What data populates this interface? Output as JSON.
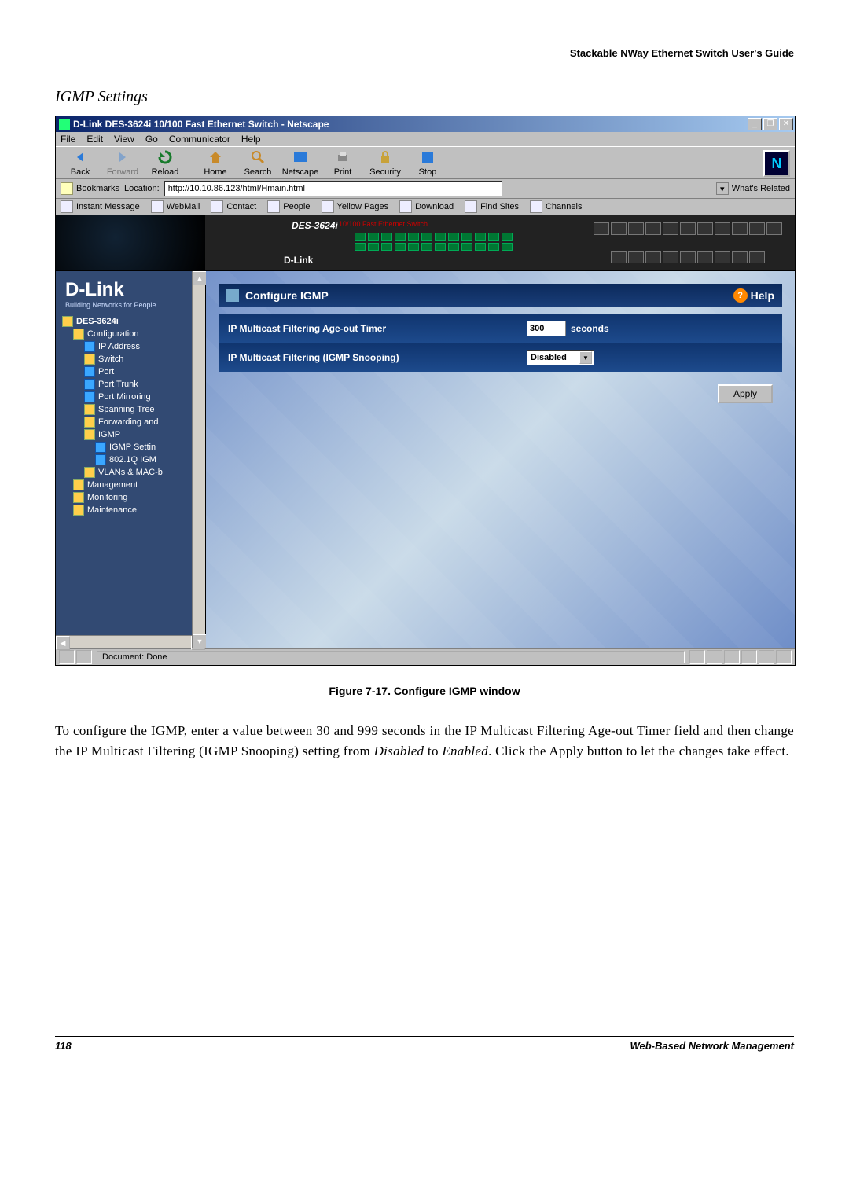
{
  "header": {
    "guide_title": "Stackable NWay Ethernet Switch User's Guide"
  },
  "section": {
    "title": "IGMP Settings"
  },
  "window": {
    "title": "D-Link DES-3624i 10/100 Fast Ethernet Switch - Netscape",
    "menu": {
      "file": "File",
      "edit": "Edit",
      "view": "View",
      "go": "Go",
      "communicator": "Communicator",
      "help": "Help"
    },
    "toolbar": {
      "back": "Back",
      "forward": "Forward",
      "reload": "Reload",
      "home": "Home",
      "search": "Search",
      "netscape": "Netscape",
      "print": "Print",
      "security": "Security",
      "stop": "Stop"
    },
    "location": {
      "bookmarks": "Bookmarks",
      "label": "Location:",
      "url": "http://10.10.86.123/html/Hmain.html",
      "related": "What's Related"
    },
    "personal": {
      "instant": "Instant Message",
      "webmail": "WebMail",
      "contact": "Contact",
      "people": "People",
      "yellow": "Yellow Pages",
      "download": "Download",
      "findsites": "Find Sites",
      "channels": "Channels"
    },
    "status": {
      "text": "Document: Done"
    }
  },
  "device": {
    "model": "DES-3624i",
    "subtitle": "10/100 Fast Ethernet Switch",
    "brand": "D-Link"
  },
  "sidebar": {
    "brand": "D-Link",
    "tagline": "Building Networks for People",
    "root": "DES-3624i",
    "items": {
      "configuration": "Configuration",
      "ip": "IP Address",
      "switch": "Switch",
      "port": "Port",
      "trunk": "Port Trunk",
      "mirror": "Port Mirroring",
      "stp": "Spanning Tree",
      "fwd": "Forwarding and",
      "igmp": "IGMP",
      "igmp_set": "IGMP Settin",
      "dot1q": "802.1Q IGM",
      "vlans": "VLANs & MAC-b",
      "mgmt": "Management",
      "mon": "Monitoring",
      "maint": "Maintenance"
    }
  },
  "panel": {
    "title": "Configure IGMP",
    "help": "Help",
    "rows": {
      "ageout_label": "IP Multicast Filtering Age-out Timer",
      "ageout_value": "300",
      "ageout_unit": "seconds",
      "snoop_label": "IP Multicast Filtering (IGMP Snooping)",
      "snoop_value": "Disabled"
    },
    "apply": "Apply"
  },
  "caption": "Figure 7-17.  Configure IGMP window",
  "paragraph": {
    "p1a": "To configure the IGMP, enter a value between 30 and 999 seconds in the IP Multicast Filtering Age-out Timer field and then change the IP Multicast Filtering (IGMP Snooping) setting from ",
    "p1b": "Disabled",
    "p1c": " to ",
    "p1d": "Enabled",
    "p1e": ". Click the Apply button to let the changes take effect."
  },
  "footer": {
    "page": "118",
    "title": "Web-Based Network Management"
  }
}
